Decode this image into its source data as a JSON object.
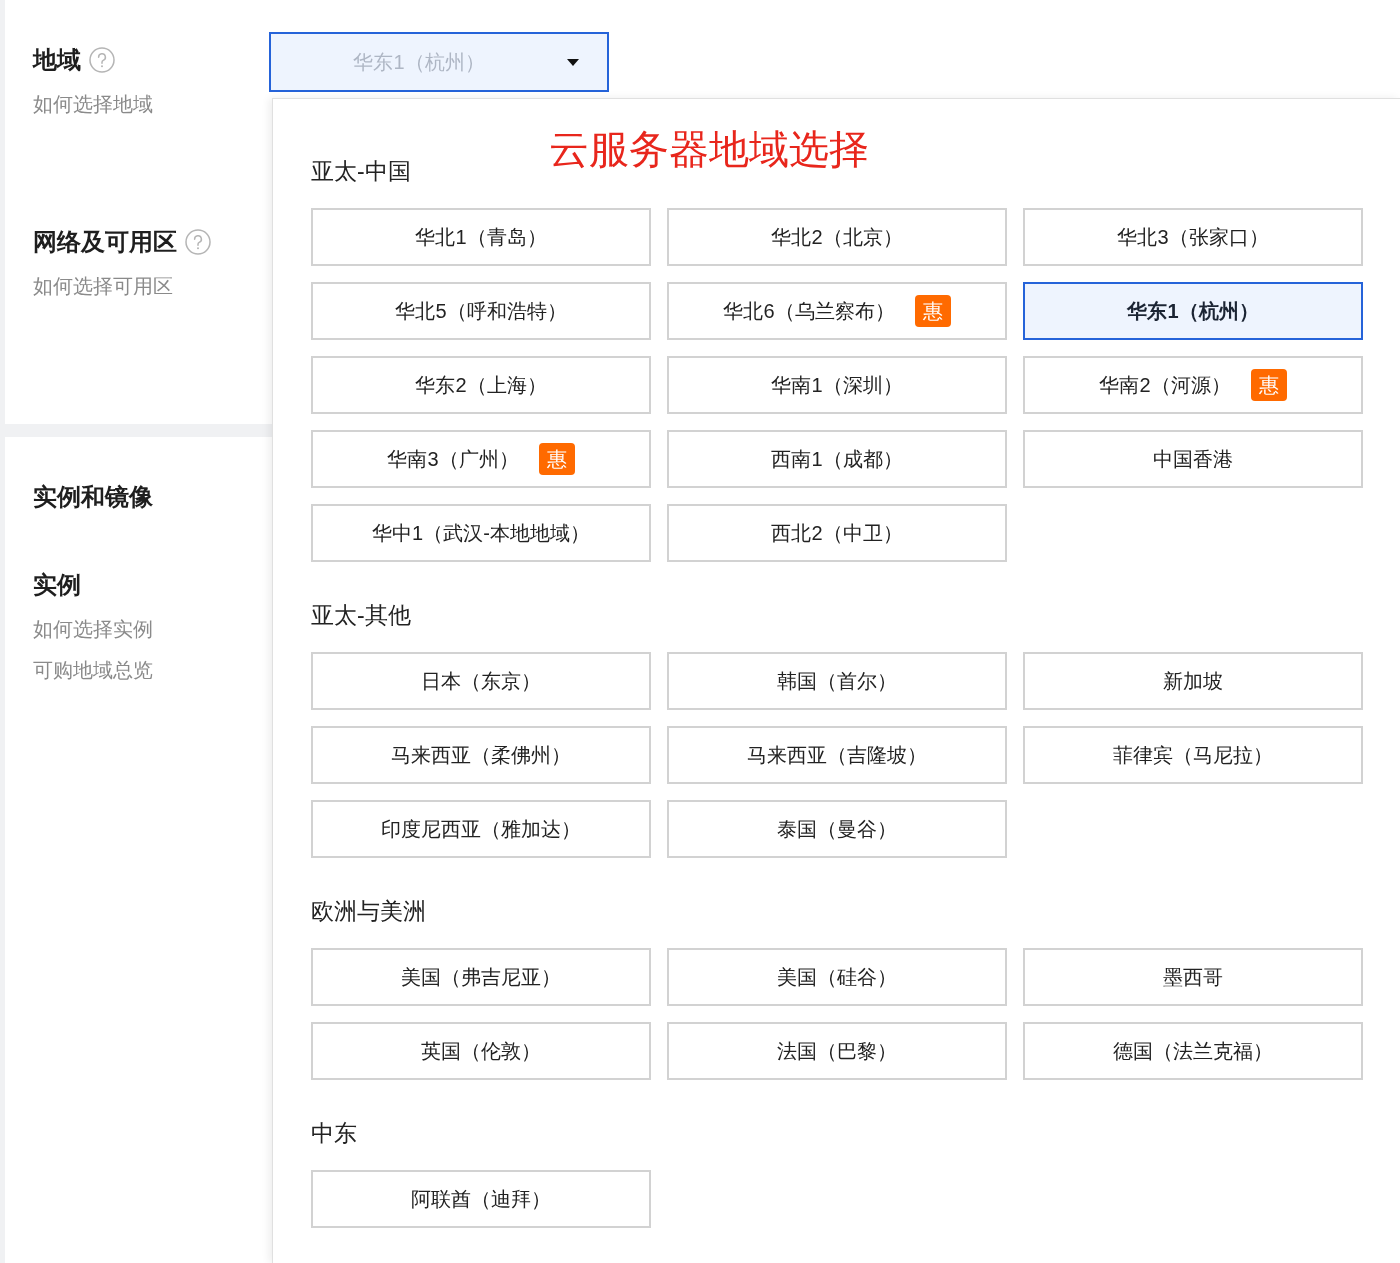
{
  "panels": [
    {
      "fields": [
        {
          "label": "地域",
          "help": true,
          "links": [
            "如何选择地域"
          ],
          "select": {
            "value": "华东1（杭州）",
            "open": true
          }
        },
        {
          "label": "网络及可用区",
          "help": true,
          "links": [
            "如何选择可用区"
          ]
        }
      ]
    },
    {
      "title": "实例和镜像",
      "fields": [
        {
          "label": "实例",
          "help": false,
          "links": [
            "如何选择实例",
            "可购地域总览"
          ]
        }
      ]
    }
  ],
  "dropdown": {
    "annotation": "云服务器地域选择",
    "groups": [
      {
        "title": "亚太-中国",
        "regions": [
          {
            "name": "华北1（青岛）",
            "selected": false
          },
          {
            "name": "华北2（北京）",
            "selected": false
          },
          {
            "name": "华北3（张家口）",
            "selected": false
          },
          {
            "name": "华北5（呼和浩特）",
            "selected": false
          },
          {
            "name": "华北6（乌兰察布）",
            "selected": false,
            "badge": "惠"
          },
          {
            "name": "华东1（杭州）",
            "selected": true
          },
          {
            "name": "华东2（上海）",
            "selected": false
          },
          {
            "name": "华南1（深圳）",
            "selected": false
          },
          {
            "name": "华南2（河源）",
            "selected": false,
            "badge": "惠"
          },
          {
            "name": "华南3（广州）",
            "selected": false,
            "badge": "惠"
          },
          {
            "name": "西南1（成都）",
            "selected": false
          },
          {
            "name": "中国香港",
            "selected": false
          },
          {
            "name": "华中1（武汉-本地地域）",
            "selected": false
          },
          {
            "name": "西北2（中卫）",
            "selected": false
          }
        ]
      },
      {
        "title": "亚太-其他",
        "regions": [
          {
            "name": "日本（东京）",
            "selected": false
          },
          {
            "name": "韩国（首尔）",
            "selected": false
          },
          {
            "name": "新加坡",
            "selected": false
          },
          {
            "name": "马来西亚（柔佛州）",
            "selected": false
          },
          {
            "name": "马来西亚（吉隆坡）",
            "selected": false
          },
          {
            "name": "菲律宾（马尼拉）",
            "selected": false
          },
          {
            "name": "印度尼西亚（雅加达）",
            "selected": false
          },
          {
            "name": "泰国（曼谷）",
            "selected": false
          }
        ]
      },
      {
        "title": "欧洲与美洲",
        "regions": [
          {
            "name": "美国（弗吉尼亚）",
            "selected": false
          },
          {
            "name": "美国（硅谷）",
            "selected": false
          },
          {
            "name": "墨西哥",
            "selected": false
          },
          {
            "name": "英国（伦敦）",
            "selected": false
          },
          {
            "name": "法国（巴黎）",
            "selected": false
          },
          {
            "name": "德国（法兰克福）",
            "selected": false
          }
        ]
      },
      {
        "title": "中东",
        "regions": [
          {
            "name": "阿联酋（迪拜）",
            "selected": false
          }
        ]
      }
    ]
  }
}
